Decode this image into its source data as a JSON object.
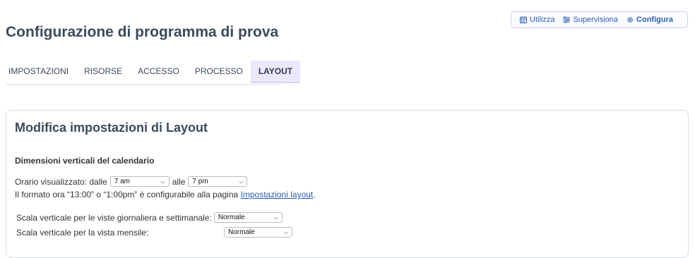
{
  "topbar": {
    "items": [
      {
        "label": "Utilizza",
        "icon": "calendar-icon"
      },
      {
        "label": "Supervisiona",
        "icon": "sliders-icon"
      },
      {
        "label": "Configura",
        "icon": "gear-icon"
      }
    ]
  },
  "page": {
    "title": "Configurazione di programma di prova"
  },
  "tabs": [
    {
      "label": "IMPOSTAZIONI"
    },
    {
      "label": "RISORSE"
    },
    {
      "label": "ACCESSO"
    },
    {
      "label": "PROCESSO"
    },
    {
      "label": "LAYOUT",
      "active": true
    }
  ],
  "card": {
    "title": "Modifica impostazioni di Layout",
    "section_title": "Dimensioni verticali del calendario",
    "orario": {
      "prefix": "Orario visualizzato: dalle",
      "from_value": "7 am",
      "middle": "alle",
      "to_value": "7 pm"
    },
    "format_note": {
      "text": "Il formato ora “13:00” o “1:00pm” è configurabile alla pagina",
      "link": "Impostazioni layout",
      "suffix": "."
    },
    "scale_week": {
      "label": "Scala verticale per le viste giornaliera e settimanale:",
      "value": "Normale"
    },
    "scale_month": {
      "label": "Scala verticale per la vista mensile:",
      "value": "Normale"
    }
  },
  "colors": {
    "accent": "#2a5db0",
    "active_tab_bg": "#ebe8fb",
    "title": "#3c4a5c"
  }
}
